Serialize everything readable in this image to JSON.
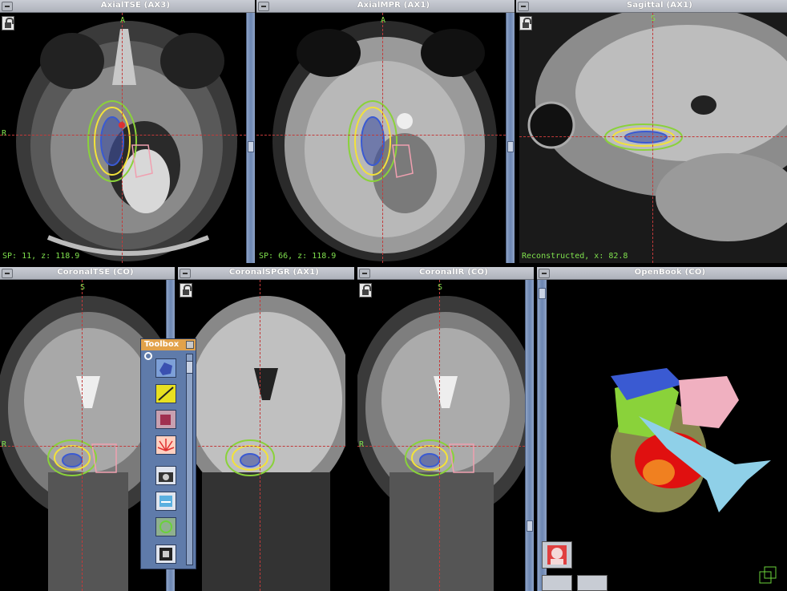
{
  "viewers": {
    "axial_tse": {
      "title": "AxialTSE (AX3)",
      "info": "SP: 11, z: 118.9",
      "label_a": "A",
      "label_r": "R"
    },
    "axial_mpr": {
      "title": "AxialMPR (AX1)",
      "info": "SP: 66, z: 118.9",
      "label_a": "A"
    },
    "sagittal": {
      "title": "Sagittal (AX1)",
      "info": "Reconstructed, x: 82.8",
      "label_s": "S"
    },
    "coronal_tse": {
      "title": "CoronalTSE (CO)",
      "label_s": "S",
      "label_r": "R"
    },
    "coronal_spgr": {
      "title": "CoronalSPGR (AX1)"
    },
    "coronal_ir": {
      "title": "CoronalIR (CO)",
      "label_s": "S",
      "label_r": "R"
    },
    "openbook": {
      "title": "OpenBook (CO)"
    }
  },
  "toolbox": {
    "title": "Toolbox"
  },
  "icons": [
    "lock-icon",
    "zoom-icon",
    "minimize-icon",
    "surface-tool-icon",
    "ruler-tool-icon",
    "cube-tool-icon",
    "burst-tool-icon",
    "camera-tool-icon",
    "segment-tool-icon",
    "contour-tool-icon",
    "grid-tool-icon",
    "head-view-icon"
  ],
  "colors": {
    "titlebar": "#b9bdc6",
    "sidebar": "#7a90b8",
    "toolbox_header": "#e2a24a",
    "crosshair": "#c23a3a",
    "overlay_text": "#7fe04d",
    "contour_yellow": "#f2e23a",
    "contour_green": "#8ad23a",
    "contour_blue": "#3a5ad2",
    "contour_pink": "#f0a0b0"
  }
}
